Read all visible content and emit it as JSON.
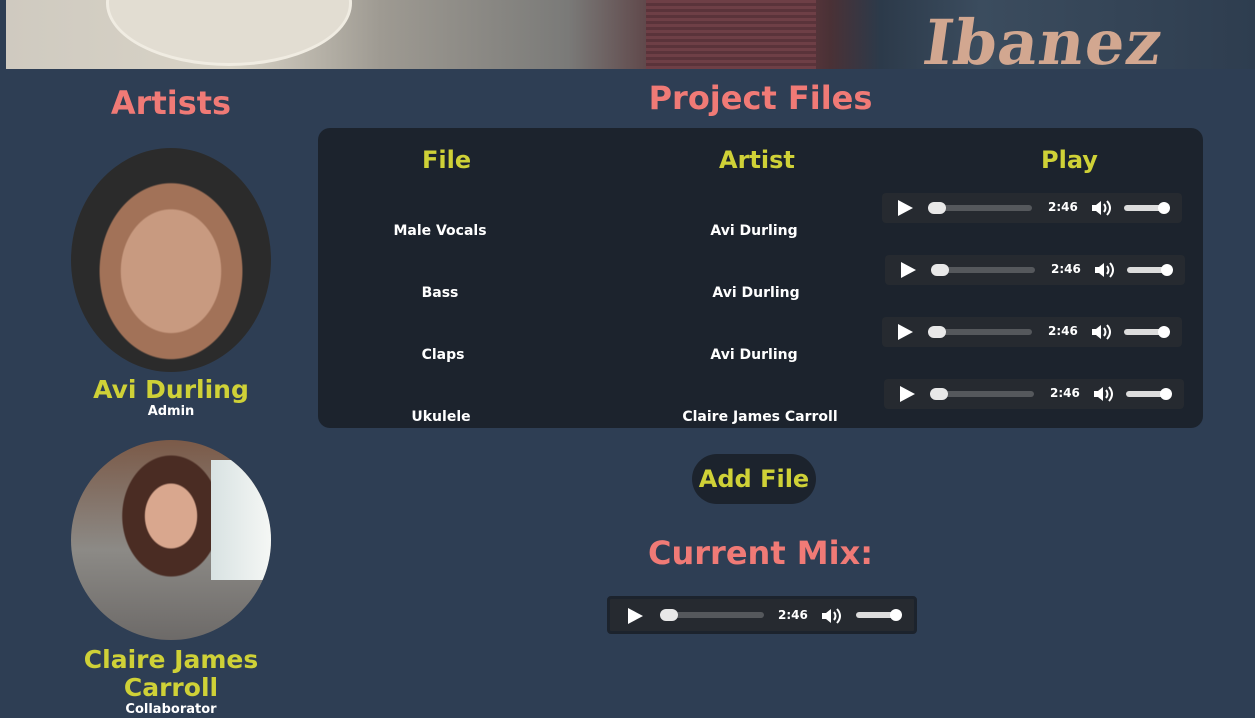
{
  "artists": {
    "title": "Artists",
    "items": [
      {
        "name": "Avi Durling",
        "role": "Admin"
      },
      {
        "name": "Claire James Carroll",
        "role": "Collaborator"
      }
    ]
  },
  "banner": {
    "logo_text": "Ibanez"
  },
  "project_files": {
    "title": "Project Files",
    "headers": {
      "file": "File",
      "artist": "Artist",
      "play": "Play"
    },
    "rows": [
      {
        "file": "Male Vocals",
        "artist": "Avi Durling",
        "time": "2:46"
      },
      {
        "file": "Bass",
        "artist": "Avi Durling",
        "time": "2:46"
      },
      {
        "file": "Claps",
        "artist": "Avi Durling",
        "time": "2:46"
      },
      {
        "file": "Ukulele",
        "artist": "Claire James Carroll",
        "time": "2:46"
      }
    ],
    "add_label": "Add File"
  },
  "current_mix": {
    "title": "Current Mix:",
    "time": "2:46"
  },
  "colors": {
    "background": "#2e3e54",
    "panel": "#1c232d",
    "title_accent": "#f07a76",
    "label_accent": "#cfd137"
  }
}
